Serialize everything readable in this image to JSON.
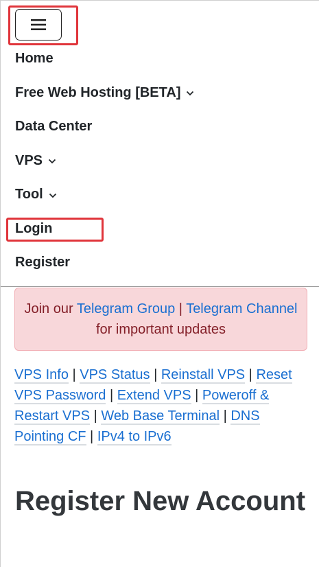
{
  "navbar": {
    "toggler_icon": "hamburger-menu-icon",
    "items": [
      {
        "label": "Home",
        "has_dropdown": false
      },
      {
        "label": "Free Web Hosting [BETA]",
        "has_dropdown": true
      },
      {
        "label": "Data Center",
        "has_dropdown": false
      },
      {
        "label": "VPS",
        "has_dropdown": true
      },
      {
        "label": "Tool",
        "has_dropdown": true
      },
      {
        "label": "Login",
        "has_dropdown": false
      },
      {
        "label": "Register",
        "has_dropdown": false
      }
    ]
  },
  "alert": {
    "prefix": "Join our ",
    "telegram_group": "Telegram Group",
    "separator": " | ",
    "telegram_channel": "Telegram Channel",
    "suffix": " for important updates"
  },
  "quick_links": [
    "VPS Info",
    "VPS Status",
    "Reinstall VPS",
    "Reset VPS Password",
    "Extend VPS",
    "Poweroff & Restart VPS",
    "Web Base Terminal",
    "DNS Pointing CF",
    "IPv4 to IPv6"
  ],
  "quick_links_separator": " | ",
  "main": {
    "title": "Register New Account"
  },
  "colors": {
    "highlight": "#e0353b",
    "link": "#1a6fd1",
    "alert_bg": "#f8d7da",
    "alert_text": "#842029"
  }
}
